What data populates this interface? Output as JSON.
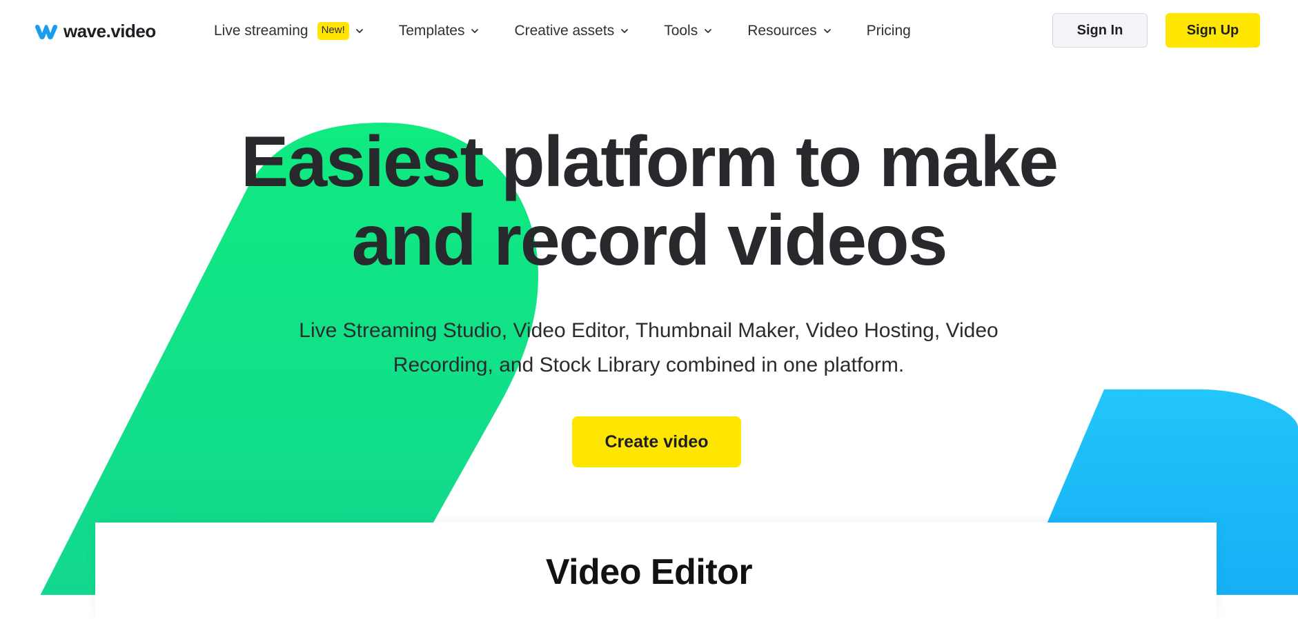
{
  "brand": {
    "name": "wave.video",
    "logo_icon": "wave-w-logo-icon",
    "logo_color": "#1a9cf0"
  },
  "nav": {
    "items": [
      {
        "label": "Live streaming",
        "badge": "New!",
        "has_dropdown": true
      },
      {
        "label": "Templates",
        "has_dropdown": true
      },
      {
        "label": "Creative assets",
        "has_dropdown": true
      },
      {
        "label": "Tools",
        "has_dropdown": true
      },
      {
        "label": "Resources",
        "has_dropdown": true
      },
      {
        "label": "Pricing",
        "has_dropdown": false
      }
    ]
  },
  "auth": {
    "signin_label": "Sign In",
    "signup_label": "Sign Up"
  },
  "hero": {
    "title_line1": "Easiest platform to make",
    "title_line2": "and record videos",
    "subtitle_line1": "Live Streaming Studio, Video Editor, Thumbnail Maker, Video Hosting, Video",
    "subtitle_line2": "Recording, and Stock Library combined in one platform.",
    "cta_label": "Create video"
  },
  "preview": {
    "title": "Video Editor"
  },
  "colors": {
    "accent_yellow": "#ffe600",
    "green_shape": "#12e67e",
    "blue_shape": "#1cbaf8",
    "text_dark": "#28292c"
  }
}
